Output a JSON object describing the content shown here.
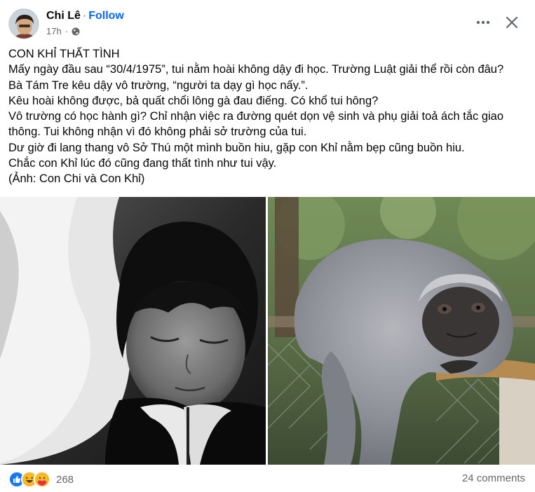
{
  "header": {
    "author": "Chi Lê",
    "separator": "·",
    "follow": "Follow",
    "time": "17h",
    "audience_icon": "globe-icon",
    "more_icon": "more-horizontal-icon",
    "close_icon": "close-icon"
  },
  "post": {
    "lines": [
      "CON KHỈ THẤT TÌNH",
      "Mấy ngày đầu sau “30/4/1975”, tui nằm hoài không dậy đi học. Trường Luật giải thể rồi còn đâu?",
      "Bà Tám Tre kêu dậy vô trường, “người ta dạy gì học nấy.”.",
      "Kêu hoài không được, bả quất chổi lông gà đau điếng. Có khổ tui hông?",
      "Vô trường có học hành gì? Chỉ nhận việc ra đường quét dọn vệ sinh và phụ giải toả ách tắc giao",
      "thông. Tui không nhận vì đó không phải sở trường của tui.",
      "Dư giờ đi lang thang vô Sở Thú một mình buồn hiu,  gặp con Khỉ nằm bẹp cũng buồn hiu.",
      "Chắc con Khỉ lúc đó cũng đang thất tình như tui vậy.",
      "(Ảnh: Con Chi và Con Khỉ)"
    ]
  },
  "photos": [
    {
      "name": "photo-woman-sleeping"
    },
    {
      "name": "photo-monkey-on-fence"
    }
  ],
  "footer": {
    "reaction_icons": [
      "like-icon",
      "haha-icon",
      "care-icon"
    ],
    "reaction_count": "268",
    "comments": "24 comments"
  },
  "colors": {
    "accent": "#0866ff",
    "secondary_text": "#65676b",
    "like_blue": "#1877f2",
    "emoji_yellow": "#f7b928"
  }
}
